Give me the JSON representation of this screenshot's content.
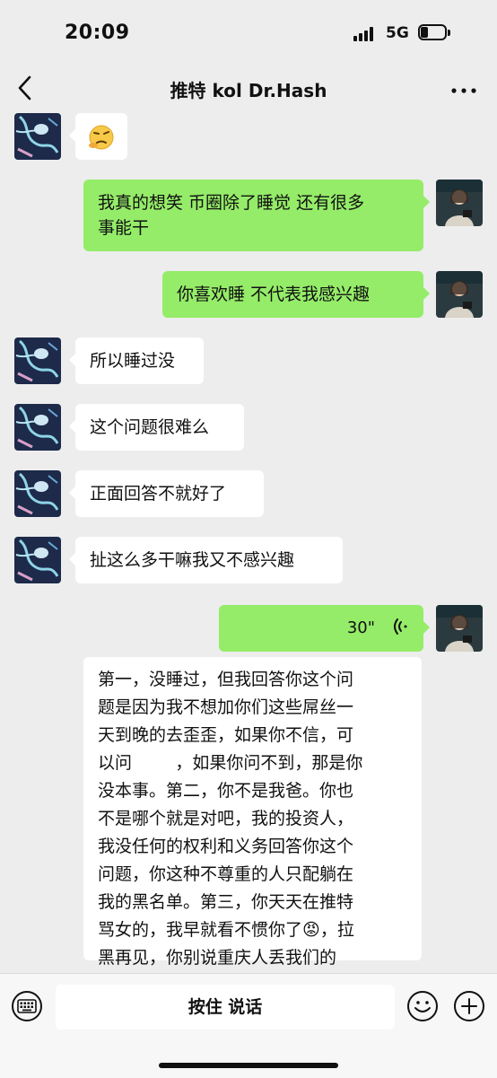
{
  "status_bar": {
    "time": "20:09",
    "network": "5G"
  },
  "nav": {
    "title": "推特 kol Dr.Hash"
  },
  "messages": [
    {
      "side": "left",
      "type": "sticker",
      "sticker_icon": "thinking-face-emoji"
    },
    {
      "side": "right",
      "type": "text",
      "text": "我真的想笑 币圈除了睡觉 还有很多\n事能干"
    },
    {
      "side": "right",
      "type": "text",
      "text": "你喜欢睡 不代表我感兴趣"
    },
    {
      "side": "left",
      "type": "text",
      "text": "所以睡过没"
    },
    {
      "side": "left",
      "type": "text",
      "text": "这个问题很难么"
    },
    {
      "side": "left",
      "type": "text",
      "text": "正面回答不就好了"
    },
    {
      "side": "left",
      "type": "text",
      "text": "扯这么多干嘛我又不感兴趣"
    },
    {
      "side": "right",
      "type": "voice",
      "duration": "30\""
    },
    {
      "side": "left",
      "type": "text",
      "text_before_emoji": "第一，没睡过，但我回答你这个问\n题是因为我不想加你们这些屌丝一\n天到晚的去歪歪，如果你不信，可\n以问        ，如果你问不到，那是你\n没本事。第二，你不是我爸。你也\n不是哪个就是对吧，我的投资人，\n我没任何的权利和义务回答你这个\n问题，你这种不尊重的人只配躺在\n我的黑名单。第三，你天天在推特\n骂女的，我早就看不惯你了",
      "emoji": "😡",
      "text_after_emoji": "，拉\n黑再见，你别说重庆人丢我们的"
    }
  ],
  "input_bar": {
    "hold_to_talk": "按住 说话"
  },
  "colors": {
    "background": "#ededed",
    "bubble_self": "#95ec69",
    "bubble_other": "#ffffff"
  }
}
